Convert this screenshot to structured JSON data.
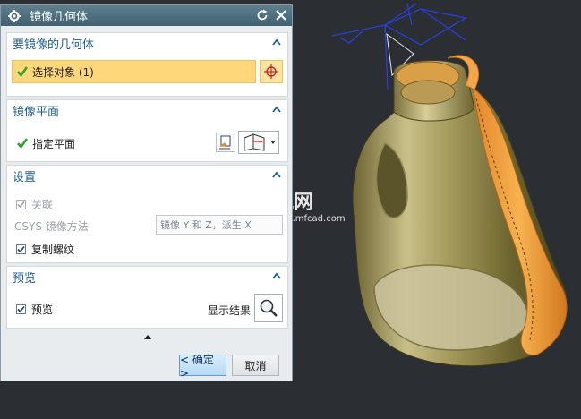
{
  "dialog": {
    "title": "镜像几何体"
  },
  "geometry_section": {
    "title": "要镜像的几何体",
    "select_object_label": "选择对象 (1)"
  },
  "plane_section": {
    "title": "镜像平面",
    "specify_plane_label": "指定平面"
  },
  "settings_section": {
    "title": "设置",
    "associative_label": "关联",
    "associative_checked": true,
    "associative_disabled": true,
    "csys_label": "CSYS 镜像方法",
    "csys_value": "镜像 Y 和 Z，派生 X",
    "copy_threads_label": "复制螺纹",
    "copy_threads_checked": true
  },
  "preview_section": {
    "title": "预览",
    "preview_label": "预览",
    "preview_checked": true,
    "show_result_label": "显示结果"
  },
  "buttons": {
    "ok_label": "< 确定 >",
    "cancel_label": "取消"
  },
  "watermark": {
    "logo_text": "沐风网",
    "url": "www.mfcad.com"
  },
  "colors": {
    "titlebar": "#4f7180",
    "section_title": "#1f5e8a",
    "selection_highlight": "#fdd77a",
    "check_green": "#2fa52f",
    "viewport_bg": "#2b2e33"
  }
}
